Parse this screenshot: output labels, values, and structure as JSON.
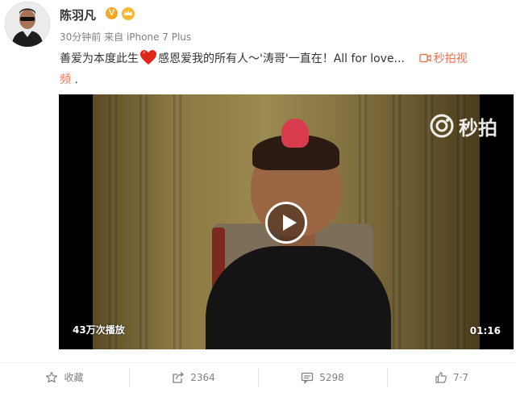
{
  "user": {
    "name": "陈羽凡",
    "verified_badge": "V"
  },
  "meta": {
    "time": "30分钟前",
    "source_prefix": "来自",
    "source": "iPhone 7 Plus"
  },
  "content": {
    "text_before_emoji": "善爱为本度此生",
    "emoji": "heart-emoji",
    "text_after_emoji": "感恩爱我的所有人～'涛哥'一直在！All for love...",
    "video_link_label": "秒拍视",
    "video_link_label_cont": "频",
    "trailing": " ."
  },
  "video": {
    "watermark": "秒拍",
    "play_count": "43万次播放",
    "duration": "01:16"
  },
  "actions": {
    "favorite_label": "收藏",
    "repost_count": "2364",
    "comment_count": "5298",
    "like_count": "7·7"
  },
  "colors": {
    "link": "#eb7350",
    "meta_text": "#808080",
    "verified": "#f5a623"
  }
}
